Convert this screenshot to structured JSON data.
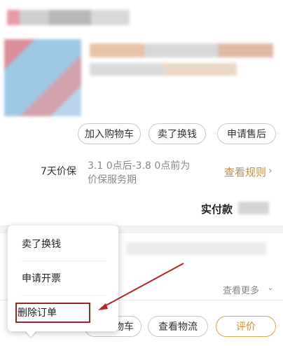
{
  "actions": {
    "add_to_cart": "加入购物车",
    "sell": "卖了换钱",
    "after_sales": "申请售后"
  },
  "price_protect": {
    "label": "7天价保",
    "desc_line1": "3.1 0点后-3.8 0点前为",
    "desc_line2": "价保服务期",
    "link": "查看规则"
  },
  "payment": {
    "label": "实付款"
  },
  "more": {
    "label": "查看更多"
  },
  "bottom_bar": {
    "partial_cart": "物车",
    "logistics": "查看物流",
    "review": "评价"
  },
  "popup_menu": {
    "items": [
      "卖了换钱",
      "申请开票",
      "删除订单"
    ]
  },
  "colors": {
    "accent_orange": "#d68a2e",
    "highlight_red": "#a02222"
  }
}
